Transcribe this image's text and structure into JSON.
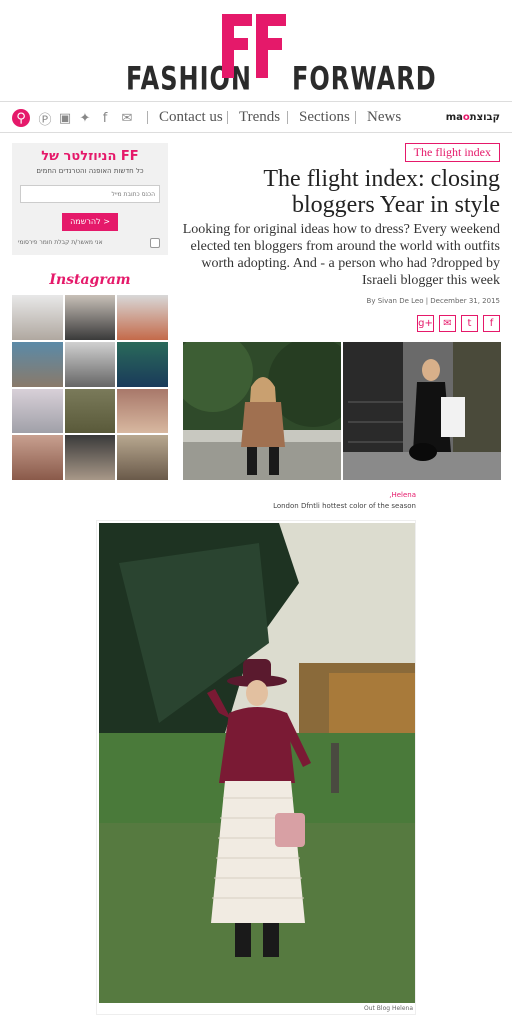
{
  "header": {
    "logo_left": "FASHION",
    "logo_mark": "FF",
    "logo_right": "FORWARD"
  },
  "nav": {
    "icons": [
      "search-icon",
      "pinterest-icon",
      "instagram-icon",
      "twitter-icon",
      "facebook-icon",
      "mail-icon"
    ],
    "links": [
      "Contact us",
      "Trends",
      "Sections",
      "News"
    ],
    "brand_left": "ma",
    "brand_o": "o",
    "brand_right": "קבוצת"
  },
  "newsletter": {
    "title": "הניוזלטר של FF",
    "subtitle": "כל חדשות האופנה והטרנדים החמים",
    "email_placeholder": "הכנס כתובת מייל",
    "submit_label": "להרשמה >",
    "consent_label": "אני מאשר/ת קבלת חומר פירסומי"
  },
  "instagram": {
    "title": "Instagram"
  },
  "article": {
    "tag": "The flight index",
    "title": "The flight index: closing bloggers Year in style",
    "lede": "Looking for original ideas how to dress? Every weekend elected ten bloggers from around the world with outfits worth adopting. And - a person who had ?dropped by Israeli blogger this week",
    "byline": "By Sivan De Leo | December 31, 2015",
    "share": [
      "g+",
      "✉",
      "t",
      "f"
    ]
  },
  "caption": {
    "name": ",Helena",
    "desc": "London Dfntli hottest color of the season"
  },
  "big_photo": {
    "credit": "Out Blog Helena"
  },
  "colors": {
    "accent": "#e5196a",
    "text": "#333333"
  }
}
